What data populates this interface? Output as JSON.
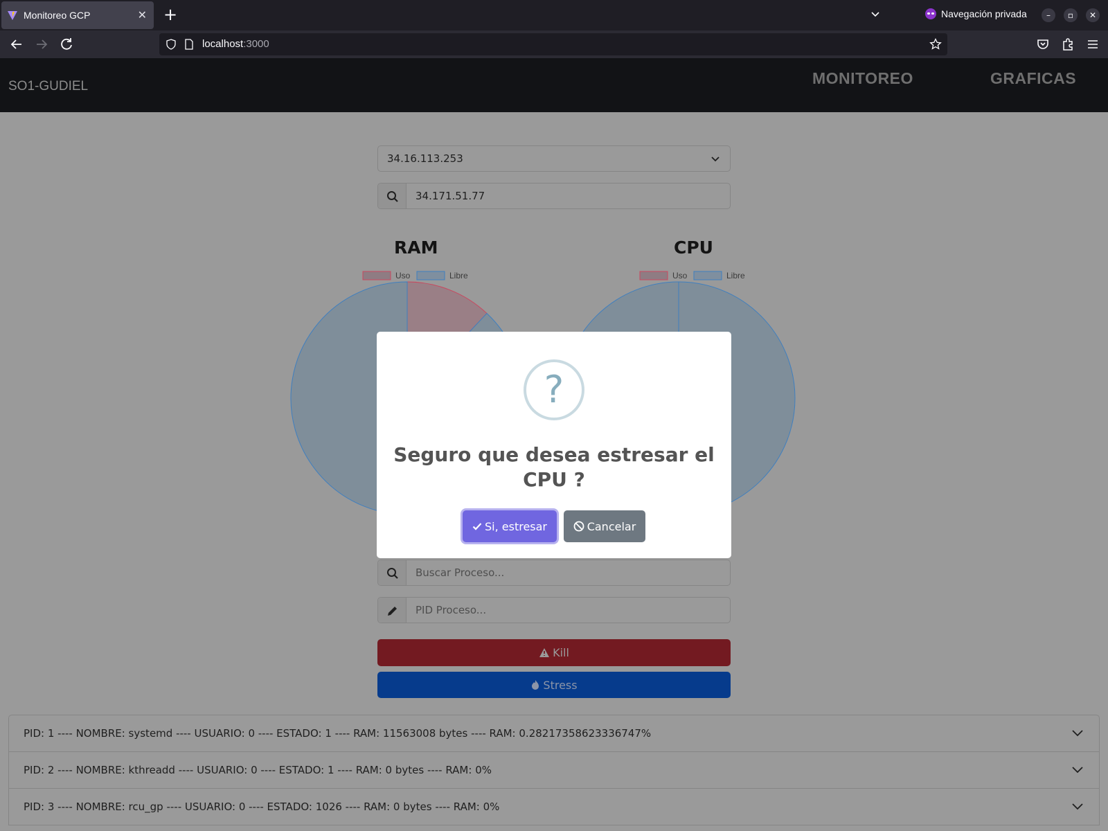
{
  "browser": {
    "tab_title": "Monitoreo GCP",
    "tab_close": "✕",
    "new_tab": "+",
    "private_label": "Navegación privada",
    "url_host": "localhost",
    "url_port": ":3000"
  },
  "header": {
    "brand": "SO1-GUDIEL",
    "nav": [
      "MONITOREO",
      "GRAFICAS"
    ]
  },
  "controls": {
    "vm_select_value": "34.16.113.253",
    "ip_search_value": "34.171.51.77",
    "process_search_placeholder": "Buscar Proceso...",
    "pid_placeholder": "PID Proceso...",
    "kill_label": "Kill",
    "stress_label": "Stress"
  },
  "charts": {
    "ram_title": "RAM",
    "cpu_title": "CPU",
    "legend": [
      "Uso",
      "Libre"
    ],
    "colors": {
      "uso": "#f25f7d",
      "libre": "#5aa5e6"
    }
  },
  "chart_data": [
    {
      "type": "pie",
      "title": "RAM",
      "categories": [
        "Uso",
        "Libre"
      ],
      "values": [
        12,
        88
      ]
    },
    {
      "type": "pie",
      "title": "CPU",
      "categories": [
        "Uso",
        "Libre"
      ],
      "values": [
        0,
        100
      ]
    }
  ],
  "processes": [
    "PID: 1 ---- NOMBRE: systemd ---- USUARIO: 0 ---- ESTADO: 1 ---- RAM: 11563008 bytes ---- RAM: 0.28217358623336747%",
    "PID: 2 ---- NOMBRE: kthreadd ---- USUARIO: 0 ---- ESTADO: 1 ---- RAM: 0 bytes ---- RAM: 0%",
    "PID: 3 ---- NOMBRE: rcu_gp ---- USUARIO: 0 ---- ESTADO: 1026 ---- RAM: 0 bytes ---- RAM: 0%"
  ],
  "modal": {
    "icon": "?",
    "title": "Seguro que desea estresar el CPU ?",
    "confirm": "Si, estresar",
    "cancel": "Cancelar"
  }
}
